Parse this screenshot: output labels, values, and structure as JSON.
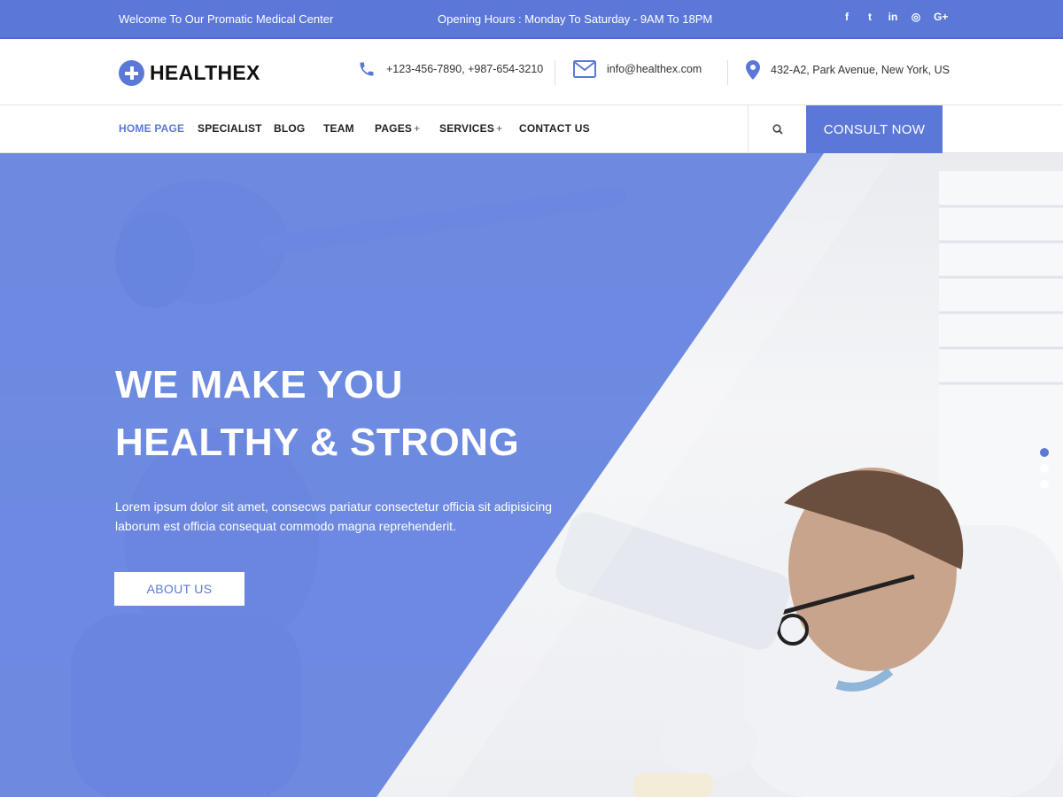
{
  "topbar": {
    "welcome": "Welcome To Our Promatic Medical Center",
    "hours": "Opening Hours : Monday To Saturday - 9AM To 18PM",
    "social": [
      {
        "icon": "facebook-icon",
        "glyph": "f"
      },
      {
        "icon": "twitter-icon",
        "glyph": "t"
      },
      {
        "icon": "linkedin-icon",
        "glyph": "in"
      },
      {
        "icon": "instagram-icon",
        "glyph": "◎"
      },
      {
        "icon": "google-plus-icon",
        "glyph": "G+"
      }
    ]
  },
  "header": {
    "logo_text": "HEALTHEX",
    "phone": "+123-456-7890, +987-654-3210",
    "email": "info@healthex.com",
    "address": "432-A2, Park Avenue, New York, US"
  },
  "nav": {
    "items": [
      {
        "label": "HOME PAGE",
        "active": true
      },
      {
        "label": "SPECIALIST"
      },
      {
        "label": "BLOG"
      },
      {
        "label": "TEAM"
      },
      {
        "label": "PAGES",
        "has_submenu": true
      },
      {
        "label": "SERVICES",
        "has_submenu": true
      },
      {
        "label": "CONTACT US"
      }
    ],
    "submenu_glyph": "+",
    "cta": "CONSULT NOW"
  },
  "hero": {
    "title_line1": "WE MAKE YOU",
    "title_line2": "HEALTHY & STRONG",
    "text_line1": "Lorem ipsum dolor sit amet, consecws pariatur consectetur officia sit adipisicing",
    "text_line2": "laborum est officia consequat commodo magna reprehenderit.",
    "button": "ABOUT US",
    "slides": 3,
    "active_slide": 1
  },
  "colors": {
    "accent": "#5b78d8",
    "text_dark": "#222222"
  }
}
